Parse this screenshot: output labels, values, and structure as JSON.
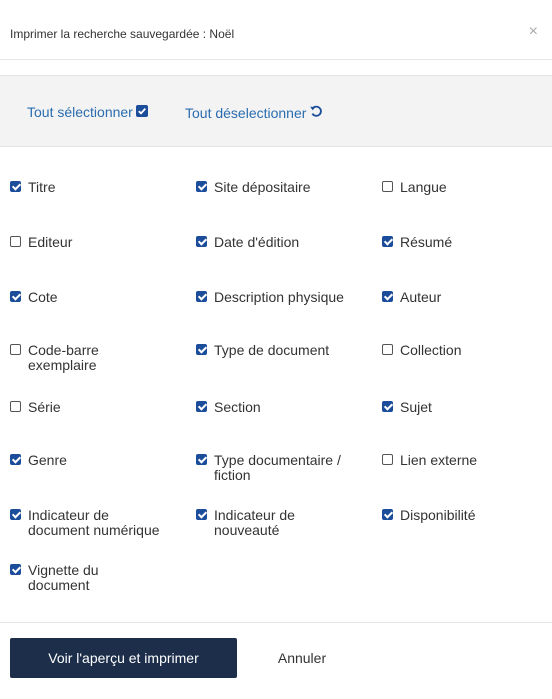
{
  "dialog": {
    "title": "Imprimer la recherche sauvegardée : Noël",
    "close_glyph": "×"
  },
  "toolbar": {
    "select_all_label": "Tout sélectionner",
    "select_all_icon": "checked-box-icon",
    "deselect_all_label": "Tout déselectionner",
    "deselect_all_icon": "undo-arrow-icon"
  },
  "options": [
    {
      "label": "Titre",
      "checked": true
    },
    {
      "label": "Site dépositaire",
      "checked": true
    },
    {
      "label": "Langue",
      "checked": false
    },
    {
      "label": "Editeur",
      "checked": false
    },
    {
      "label": "Date d'édition",
      "checked": true
    },
    {
      "label": "Résumé",
      "checked": true
    },
    {
      "label": "Cote",
      "checked": true
    },
    {
      "label": "Description physique",
      "checked": true
    },
    {
      "label": "Auteur",
      "checked": true
    },
    {
      "label": "Code-barre exemplaire",
      "checked": false
    },
    {
      "label": "Type de document",
      "checked": true
    },
    {
      "label": "Collection",
      "checked": false
    },
    {
      "label": "Série",
      "checked": false
    },
    {
      "label": "Section",
      "checked": true
    },
    {
      "label": "Sujet",
      "checked": true
    },
    {
      "label": "Genre",
      "checked": true
    },
    {
      "label": "Type documentaire / fiction",
      "checked": true
    },
    {
      "label": "Lien externe",
      "checked": false
    },
    {
      "label": "Indicateur de document numérique",
      "checked": true
    },
    {
      "label": "Indicateur de nouveauté",
      "checked": true
    },
    {
      "label": "Disponibilité",
      "checked": true
    },
    {
      "label": "Vignette du document",
      "checked": true
    }
  ],
  "footer": {
    "preview_print_label": "Voir l'aperçu et imprimer",
    "cancel_label": "Annuler"
  },
  "colors": {
    "accent": "#1b4d9b",
    "link": "#2a6db0",
    "primary_button": "#1c2e4a"
  }
}
